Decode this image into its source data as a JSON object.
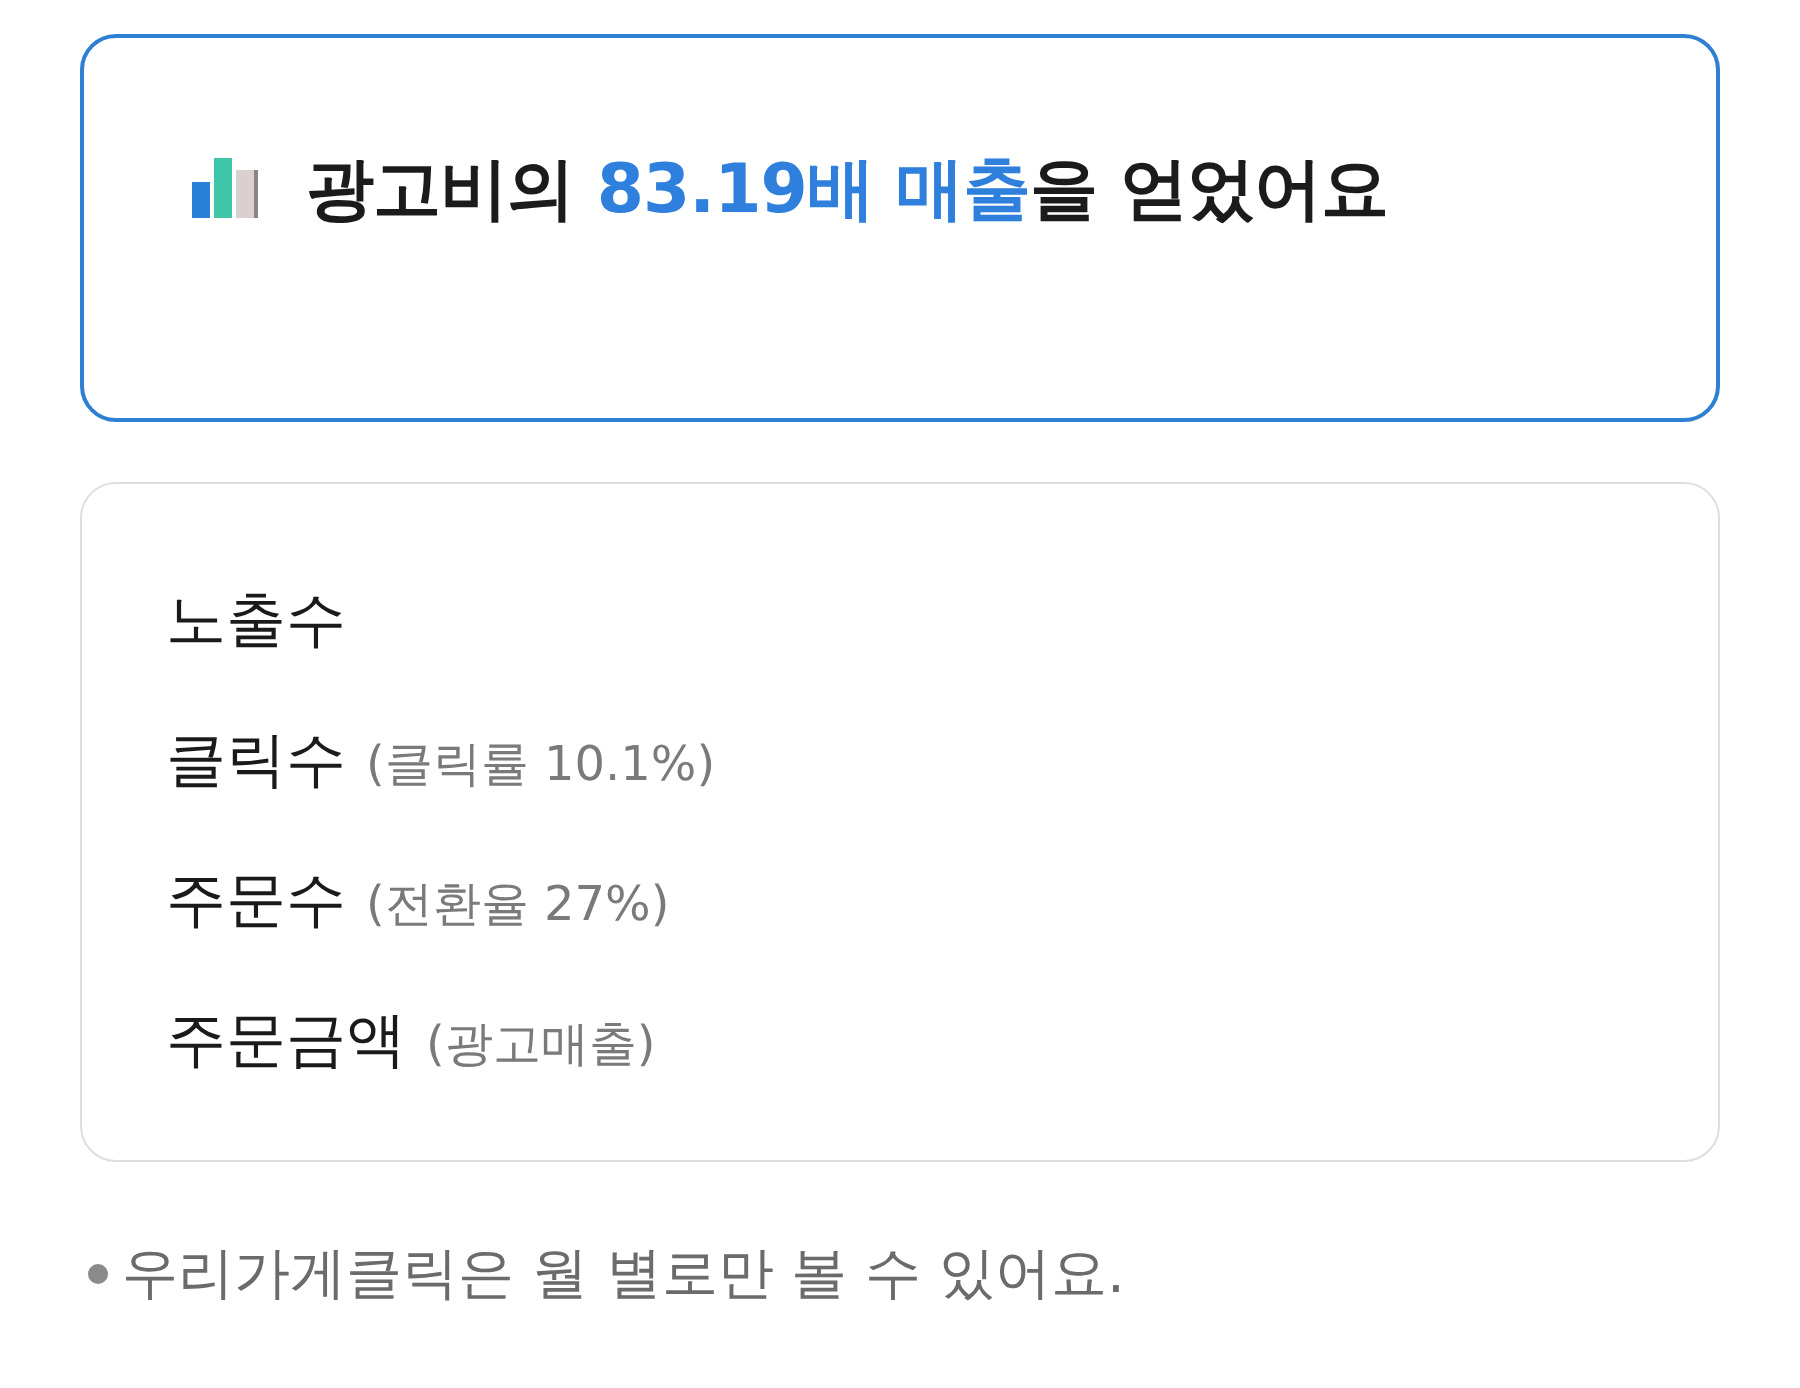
{
  "summary": {
    "title_parts": [
      {
        "text": "광고비의 ",
        "highlight": false
      },
      {
        "text": "83.19배 매출",
        "highlight": true
      },
      {
        "text": "을 얻었어요",
        "highlight": false
      }
    ]
  },
  "metrics": [
    {
      "label": "노출수"
    },
    {
      "label": "클릭수",
      "note": "(클릭률 10.1%)"
    },
    {
      "label": "주문수",
      "note": "(전환율 27%)"
    },
    {
      "label": "주문금액",
      "note": "(광고매출)"
    }
  ],
  "footnote": {
    "text": "우리가게클릭은 월 별로만 볼 수 있어요."
  }
}
